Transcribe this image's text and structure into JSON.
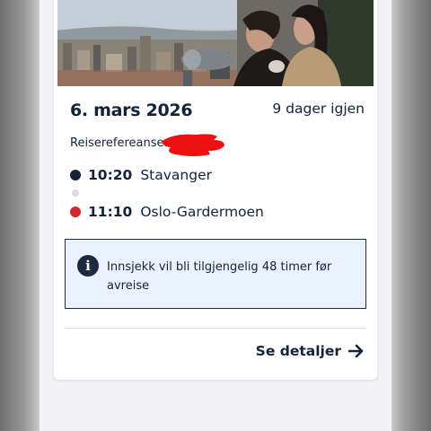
{
  "trip": {
    "date": "6. mars 2026",
    "days_left": "9 dager igjen",
    "reference_label": "Reiserefereanse:",
    "reference_value_hidden": true
  },
  "itinerary": {
    "departure": {
      "time": "10:20",
      "place": "Stavanger"
    },
    "arrival": {
      "time": "11:10",
      "place": "Oslo-Gardermoen"
    }
  },
  "notice": {
    "icon": "info-icon",
    "text": "Innsjekk vil bli tilgjengelig 48 timer før avreise"
  },
  "actions": {
    "details_label": "Se detaljer",
    "details_icon": "arrow-right-icon"
  },
  "colors": {
    "navy": "#14233a",
    "accent_red": "#d7282f",
    "notice_bg": "#eaf2fd",
    "redaction": "#ee1111"
  }
}
